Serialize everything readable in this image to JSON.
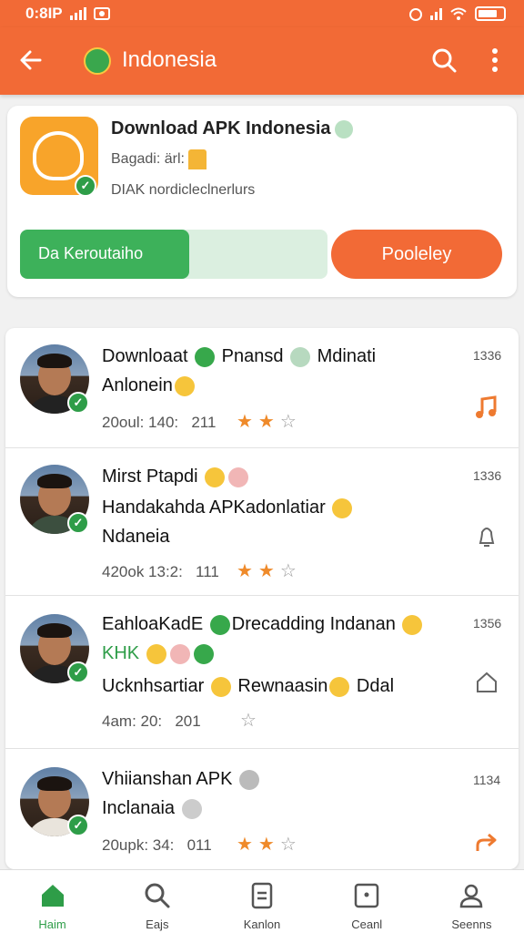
{
  "status_bar": {
    "time": "0:8IP",
    "icons": [
      "signal-icon",
      "photo-icon",
      "alarm-icon",
      "wifi-icon",
      "battery-icon"
    ]
  },
  "app_bar": {
    "title": "Indonesia",
    "icons": [
      "back-arrow-icon",
      "indonesia-flag-icon",
      "search-icon",
      "more-vert-icon"
    ],
    "color": "#f26a36"
  },
  "app_card": {
    "name": "Download APK Indonesia",
    "line1": "Bagadi: ärl:",
    "line2": "DIAK nordicleclnerlurs",
    "progress_label": "Da Keroutaiho",
    "progress_percent": 55,
    "action_label": "Pooleley"
  },
  "posts": [
    {
      "title": "Downloaat",
      "title2": "Pnansd",
      "title3": "Mdinati",
      "line2": "Anlonein",
      "meta1": "20oul: 140:",
      "meta2": "211",
      "stars": 2,
      "time": "1336",
      "icon": "music-note-icon"
    },
    {
      "title": "Mirst Ptapdi",
      "line2": "Handakahda APKadonlatiar",
      "line3": "Ndaneia",
      "meta1": "420ok 13:2:",
      "meta2": "111",
      "stars": 2,
      "time": "1336",
      "icon": "bell-icon"
    },
    {
      "title": "EahloaKadE",
      "title2": "Drecadding Indanan",
      "line2": "KHK",
      "line3": "Ucknhsartiar",
      "line3b": "Rewnaasin",
      "line3c": "Ddal",
      "meta1": "4am: 20:",
      "meta2": "201",
      "stars": 0,
      "time": "1356",
      "icon": "home-icon"
    },
    {
      "title": "Vhiianshan APK",
      "line2": "Inclanaia",
      "meta1": "20upk: 34:",
      "meta2": "011",
      "stars": 2,
      "time": "1134",
      "icon": "share-icon"
    }
  ],
  "bottom_nav": [
    {
      "label": "Haim",
      "icon": "home-icon",
      "active": true
    },
    {
      "label": "Eajs",
      "icon": "search-icon",
      "active": false
    },
    {
      "label": "Kanlon",
      "icon": "document-icon",
      "active": false
    },
    {
      "label": "Ceanl",
      "icon": "inbox-icon",
      "active": false
    },
    {
      "label": "Seenns",
      "icon": "profile-icon",
      "active": false
    }
  ]
}
